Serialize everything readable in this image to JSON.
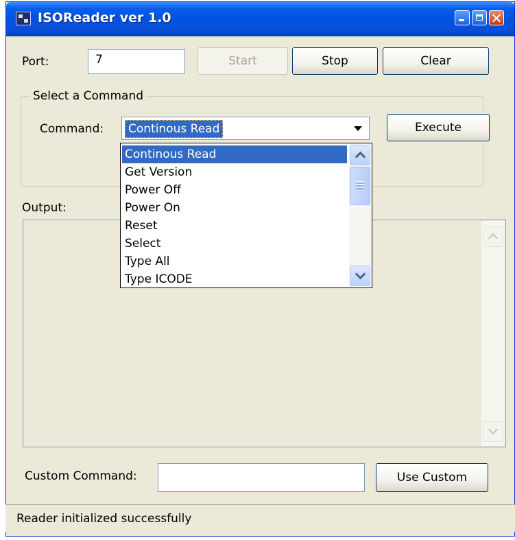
{
  "window": {
    "title": "ISOReader ver 1.0",
    "minimize_icon": "minimize-icon",
    "maximize_icon": "maximize-icon",
    "close_icon": "close-icon"
  },
  "port": {
    "label": "Port:",
    "value": "7"
  },
  "buttons": {
    "start": "Start",
    "stop": "Stop",
    "clear": "Clear",
    "execute": "Execute",
    "use_custom": "Use Custom"
  },
  "command_group": {
    "title": "Select a Command",
    "label": "Command:",
    "selected": "Continous Read",
    "options": [
      "Continous Read",
      "Get Version",
      "Power Off",
      "Power On",
      "Reset",
      "Select",
      "Type All",
      "Type ICODE"
    ]
  },
  "output": {
    "label": "Output:"
  },
  "custom": {
    "label": "Custom Command:",
    "value": ""
  },
  "status": {
    "text": "Reader initialized successfully"
  },
  "colors": {
    "selection": "#316ac5",
    "titlebar": "#0054e3",
    "face": "#ece9d8"
  }
}
